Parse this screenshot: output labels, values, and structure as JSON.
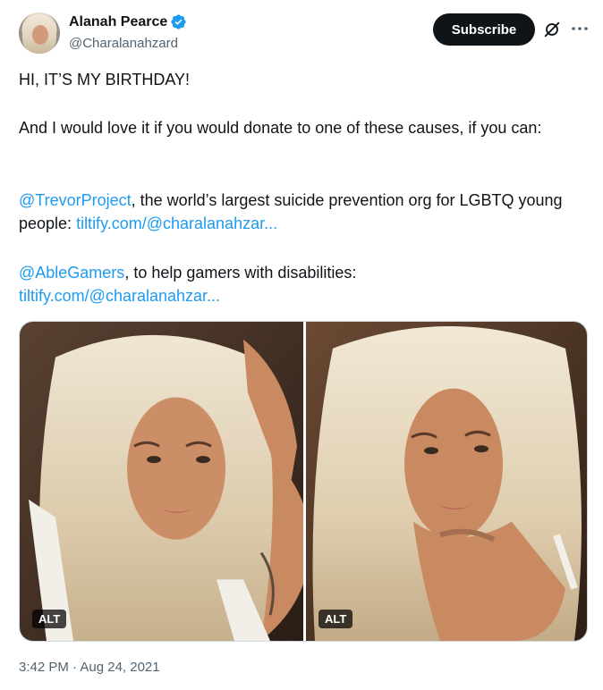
{
  "author": {
    "display_name": "Alanah Pearce",
    "handle": "@Charalanahzard",
    "verified_icon": "verified-badge-icon",
    "avatar_icon": "avatar"
  },
  "actions": {
    "subscribe_label": "Subscribe",
    "grok_icon": "grok-icon",
    "more_icon": "more-icon"
  },
  "tweet": {
    "line1": "HI, IT’S MY BIRTHDAY!",
    "line2": "And I would love it if you would donate to one of these causes, if you can:",
    "cause1": {
      "mention": "@TrevorProject",
      "text": ", the world’s largest suicide prevention org for LGBTQ young people: ",
      "link": "tiltify.com/@charalanahzar..."
    },
    "cause2": {
      "mention": "@AbleGamers",
      "text": ", to help gamers with disabilities:",
      "link": "tiltify.com/@charalanahzar..."
    }
  },
  "media": [
    {
      "alt_label": "ALT"
    },
    {
      "alt_label": "ALT"
    }
  ],
  "meta": {
    "timestamp": "3:42 PM · Aug 24, 2021"
  },
  "colors": {
    "link": "#1d9bf0",
    "text": "#0f1419",
    "secondary": "#536471",
    "button_bg": "#0f1419"
  }
}
